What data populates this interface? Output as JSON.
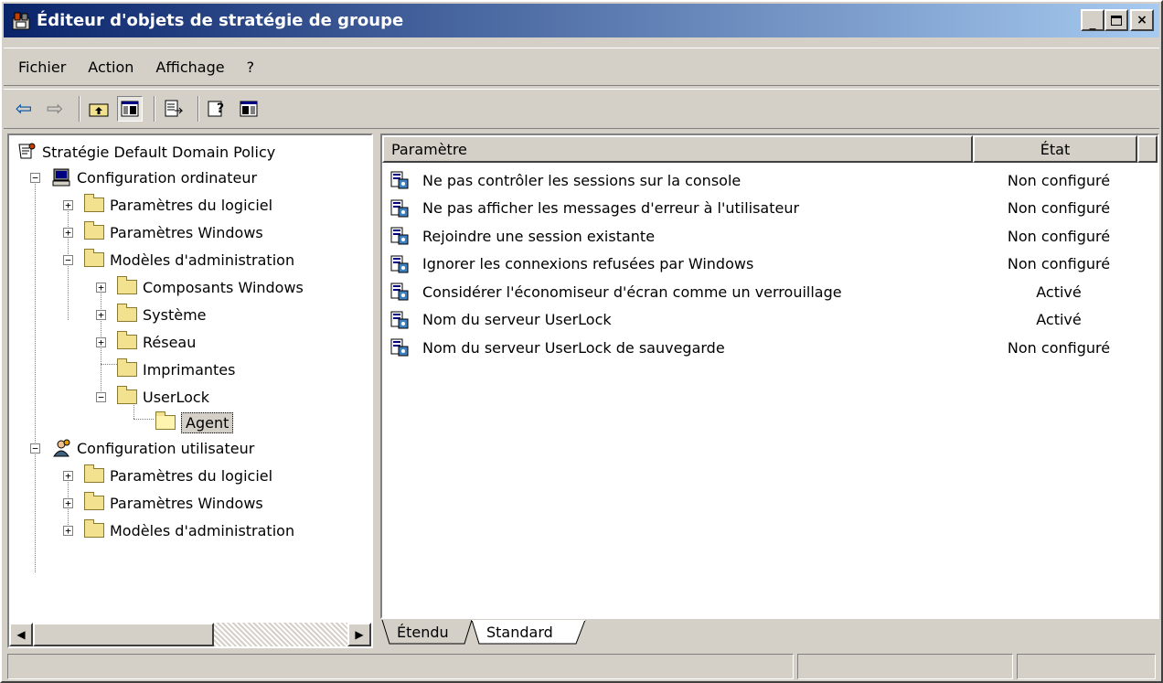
{
  "window": {
    "title": "Éditeur d'objets de stratégie de groupe",
    "min_label": "_",
    "max_label": "□",
    "close_label": "×"
  },
  "menubar": {
    "items": [
      "Fichier",
      "Action",
      "Affichage",
      "?"
    ]
  },
  "toolbar": {
    "back": "⇦",
    "forward": "⇨"
  },
  "tree": {
    "root": "Stratégie Default Domain Policy",
    "computer": {
      "label": "Configuration ordinateur",
      "children": [
        "Paramètres du logiciel",
        "Paramètres Windows",
        "Modèles d'administration"
      ],
      "admin_children": [
        "Composants Windows",
        "Système",
        "Réseau",
        "Imprimantes",
        "UserLock"
      ],
      "userlock_child": "Agent"
    },
    "user": {
      "label": "Configuration utilisateur",
      "children": [
        "Paramètres du logiciel",
        "Paramètres Windows",
        "Modèles d'administration"
      ]
    }
  },
  "list": {
    "columns": [
      "Paramètre",
      "État"
    ],
    "rows": [
      {
        "name": "Ne pas contrôler les sessions sur la console",
        "state": "Non configuré"
      },
      {
        "name": "Ne pas afficher les messages d'erreur à l'utilisateur",
        "state": "Non configuré"
      },
      {
        "name": "Rejoindre une session existante",
        "state": "Non configuré"
      },
      {
        "name": "Ignorer les connexions refusées par Windows",
        "state": "Non configuré"
      },
      {
        "name": "Considérer l'économiseur d'écran comme un verrouillage",
        "state": "Activé"
      },
      {
        "name": "Nom du serveur UserLock",
        "state": "Activé"
      },
      {
        "name": "Nom du serveur UserLock de sauvegarde",
        "state": "Non configuré"
      }
    ]
  },
  "tabs": [
    "Étendu",
    "Standard"
  ],
  "colors": {
    "titlebar_start": "#0a246a",
    "titlebar_end": "#a6caf0",
    "face": "#d4d0c8"
  }
}
